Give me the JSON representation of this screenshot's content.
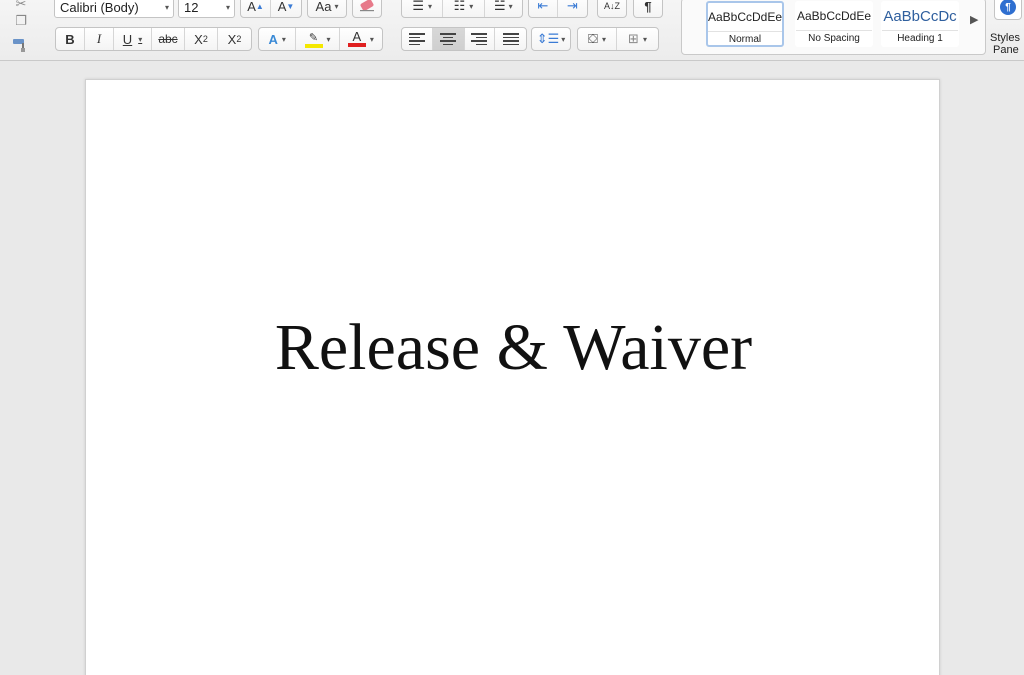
{
  "ribbon": {
    "font_name": "Calibri (Body)",
    "font_size": "12",
    "grow_font": "A",
    "shrink_font": "A",
    "change_case": "Aa",
    "bold": "B",
    "italic": "I",
    "underline": "U",
    "strikethrough": "abc",
    "subscript": "X",
    "subscript_mark": "2",
    "superscript": "X",
    "superscript_mark": "2",
    "text_effects": "A",
    "font_color_letter": "A",
    "sort_mark": "A↓Z",
    "show_formatting": "¶",
    "highlight_color": "#f4e800",
    "font_color": "#e02020"
  },
  "styles": {
    "items": [
      {
        "preview": "AaBbCcDdEe",
        "name": "Normal"
      },
      {
        "preview": "AaBbCcDdEe",
        "name": "No Spacing"
      },
      {
        "preview": "AaBbCcDc",
        "name": "Heading 1"
      }
    ],
    "pane_label_line1": "Styles",
    "pane_label_line2": "Pane",
    "pane_icon": "¶",
    "heading_color": "#2f5f9e"
  },
  "document": {
    "title": "Release & Waiver"
  }
}
